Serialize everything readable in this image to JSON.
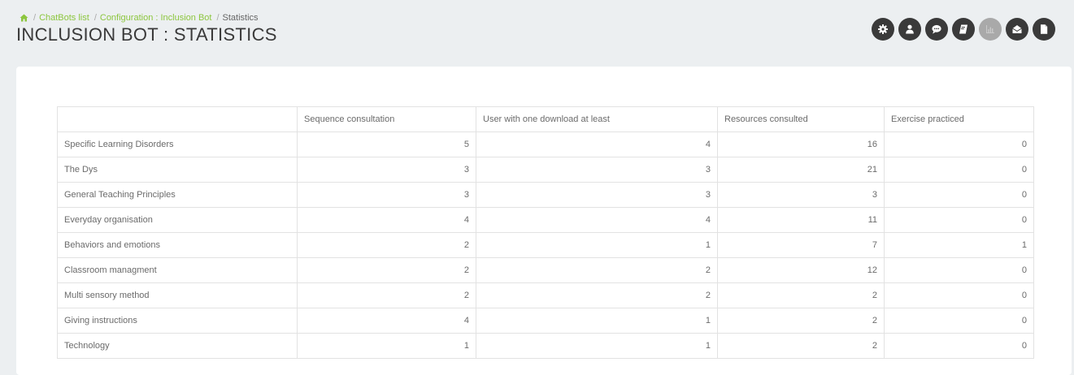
{
  "breadcrumb": {
    "home_icon": "home-icon",
    "items": [
      "ChatBots list",
      "Configuration : Inclusion Bot",
      "Statistics"
    ],
    "separator": "/",
    "link_color": "#8cc63e"
  },
  "page_title": "INCLUSION BOT : STATISTICS",
  "toolbar": {
    "buttons": [
      {
        "icon": "gear-icon",
        "active": true
      },
      {
        "icon": "user-icon",
        "active": true
      },
      {
        "icon": "chat-bubble-icon",
        "active": true
      },
      {
        "icon": "book-icon",
        "active": true
      },
      {
        "icon": "bar-chart-icon",
        "active": false
      },
      {
        "icon": "mail-open-icon",
        "active": true
      },
      {
        "icon": "document-icon",
        "active": true
      }
    ],
    "active_color": "#3a3a3a",
    "inactive_color": "#a9a9a9"
  },
  "table": {
    "headers": [
      "",
      "Sequence consultation",
      "User with one download at least",
      "Resources consulted",
      "Exercise practiced"
    ],
    "rows": [
      {
        "label": "Specific Learning Disorders",
        "values": [
          "5",
          "4",
          "16",
          "0"
        ]
      },
      {
        "label": "The Dys",
        "values": [
          "3",
          "3",
          "21",
          "0"
        ]
      },
      {
        "label": "General Teaching Principles",
        "values": [
          "3",
          "3",
          "3",
          "0"
        ]
      },
      {
        "label": "Everyday organisation",
        "values": [
          "4",
          "4",
          "11",
          "0"
        ]
      },
      {
        "label": "Behaviors and emotions",
        "values": [
          "2",
          "1",
          "7",
          "1"
        ]
      },
      {
        "label": "Classroom managment",
        "values": [
          "2",
          "2",
          "12",
          "0"
        ]
      },
      {
        "label": "Multi sensory method",
        "values": [
          "2",
          "2",
          "2",
          "0"
        ]
      },
      {
        "label": "Giving instructions",
        "values": [
          "4",
          "1",
          "2",
          "0"
        ]
      },
      {
        "label": "Technology",
        "values": [
          "1",
          "1",
          "2",
          "0"
        ]
      }
    ]
  }
}
